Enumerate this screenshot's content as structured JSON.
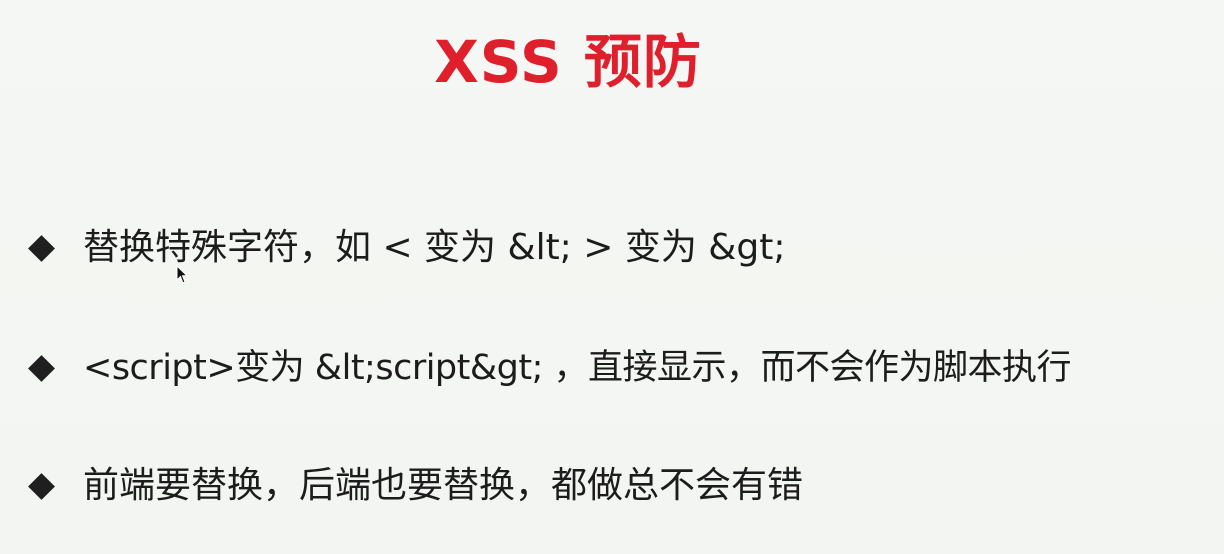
{
  "slide": {
    "title": "XSS 预防",
    "bullets": [
      "替换特殊字符，如 < 变为 &lt; > 变为 &gt;",
      "<script>变为 &lt;script&gt; ，直接显示，而不会作为脚本执行",
      "前端要替换，后端也要替换，都做总不会有错"
    ]
  },
  "colors": {
    "title": "#e01f2c",
    "text": "#1c1c1c",
    "background": "#f4f6f3"
  },
  "icons": {
    "bullet": "diamond-bullet-icon",
    "cursor": "mouse-pointer-icon"
  }
}
